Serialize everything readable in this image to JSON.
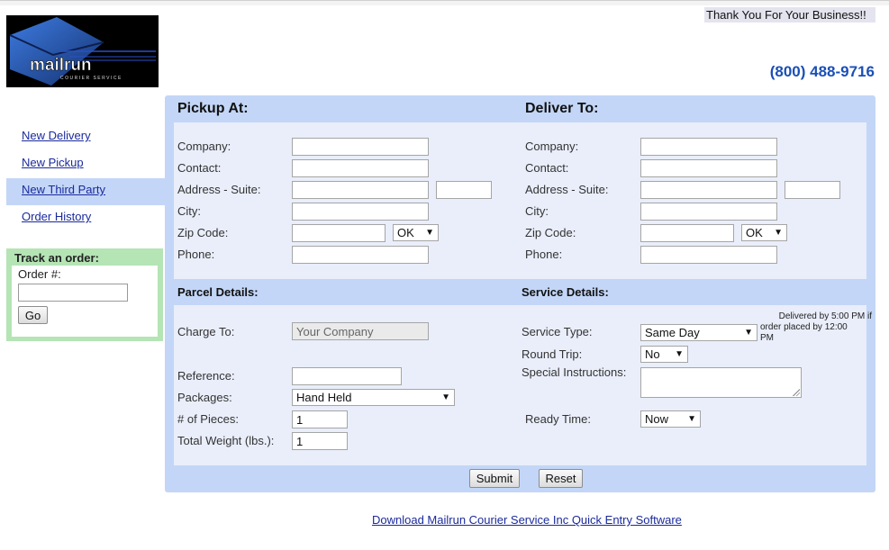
{
  "header": {
    "logo_text": "mailrun",
    "logo_tagline": "COURIER SERVICE",
    "thanks": "Thank You For Your Business!!",
    "phone": "(800) 488-9716"
  },
  "nav": {
    "items": [
      {
        "label": "New Delivery"
      },
      {
        "label": "New Pickup"
      },
      {
        "label": "New Third Party"
      },
      {
        "label": "Order History"
      }
    ]
  },
  "track": {
    "title": "Track an order:",
    "order_label": "Order #:",
    "order_value": "",
    "go_label": "Go"
  },
  "pickup": {
    "title": "Pickup At:",
    "company_label": "Company:",
    "contact_label": "Contact:",
    "address_label": "Address - Suite:",
    "city_label": "City:",
    "zip_label": "Zip Code:",
    "state_value": "OK",
    "phone_label": "Phone:"
  },
  "deliver": {
    "title": "Deliver To:",
    "company_label": "Company:",
    "contact_label": "Contact:",
    "address_label": "Address - Suite:",
    "city_label": "City:",
    "zip_label": "Zip Code:",
    "state_value": "OK",
    "phone_label": "Phone:"
  },
  "parcel": {
    "title": "Parcel Details:",
    "charge_label": "Charge To:",
    "charge_placeholder": "Your Company",
    "reference_label": "Reference:",
    "packages_label": "Packages:",
    "packages_value": "Hand Held",
    "pieces_label": "# of Pieces:",
    "pieces_value": "1",
    "weight_label": "Total Weight (lbs.):",
    "weight_value": "1"
  },
  "service": {
    "title": "Service Details:",
    "type_label": "Service Type:",
    "type_value": "Same Day",
    "note_line1": "Delivered by 5:00 PM if",
    "note_line2": "order placed by 12:00",
    "note_line3": "PM",
    "round_trip_label": "Round Trip:",
    "round_trip_value": "No",
    "instructions_label": "Special Instructions:",
    "ready_label": "Ready Time:",
    "ready_value": "Now"
  },
  "actions": {
    "submit_label": "Submit",
    "reset_label": "Reset"
  },
  "footer": {
    "download_link": "Download Mailrun Courier Service Inc Quick Entry Software"
  },
  "colors": {
    "panel": "#c3d6f7",
    "inner": "#e9eefa",
    "track": "#b5e4b5",
    "phone": "#1a4fb6",
    "link": "#1a2a9c"
  }
}
